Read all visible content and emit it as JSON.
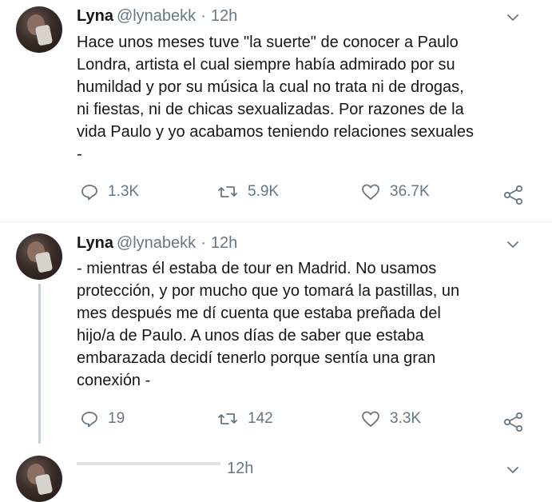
{
  "tweets": [
    {
      "name": "Lyna",
      "handle": "@lynabekk",
      "separator": "·",
      "time": "12h",
      "text": "Hace unos meses tuve \"la suerte\" de conocer a Paulo\nLondra, artista el cual siempre había admirado por su\nhumildad y por su música la cual no trata ni de drogas,\nni fiestas, ni de chicas sexualizadas. Por razones de la\nvida Paulo y yo acabamos teniendo relaciones sexuales\n-",
      "replies": "1.3K",
      "retweets": "5.9K",
      "likes": "36.7K"
    },
    {
      "name": "Lyna",
      "handle": "@lynabekk",
      "separator": "·",
      "time": "12h",
      "text": "- mientras él estaba de tour en Madrid. No usamos\nprotección, y por mucho que yo tomará la pastillas, un\nmes después me dí cuenta que estaba preñada del\nhijo/a de Paulo. A unos días de saber que estaba\nembarazada decidí tenerlo porque sentía una gran\nconexión -",
      "replies": "19",
      "retweets": "142",
      "likes": "3.3K"
    },
    {
      "time": "12h"
    }
  ],
  "icons": {
    "reply": "reply-icon",
    "retweet": "retweet-icon",
    "like": "heart-icon",
    "share": "share-icon",
    "menu": "chevron-down-icon"
  },
  "colors": {
    "text": "#14171a",
    "secondary": "#657786",
    "divider": "#e6ecf0",
    "thread_line": "#c4cfd6"
  }
}
